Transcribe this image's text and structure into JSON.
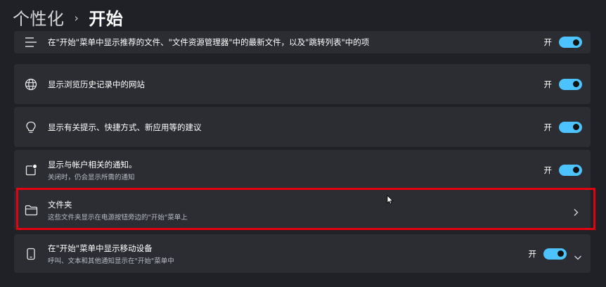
{
  "header": {
    "parent": "个性化",
    "separator": "›",
    "current": "开始"
  },
  "rows": [
    {
      "icon": "list-lines-icon",
      "title": "在\"开始\"菜单中显示推荐的文件、\"文件资源管理器\"中的最新文件，以及\"跳转列表\"中的项",
      "toggle_label": "开",
      "toggle_on": true
    },
    {
      "icon": "globe-icon",
      "title": "显示浏览历史记录中的网站",
      "toggle_label": "开",
      "toggle_on": true
    },
    {
      "icon": "lightbulb-icon",
      "title": "显示有关提示、快捷方式、新应用等的建议",
      "toggle_label": "开",
      "toggle_on": true
    },
    {
      "icon": "account-notification-icon",
      "title": "显示与帐户相关的通知。",
      "subtitle": "关闭时，仍会显示所需的通知",
      "toggle_label": "开",
      "toggle_on": true
    },
    {
      "icon": "folder-icon",
      "title": "文件夹",
      "subtitle": "这些文件夹显示在电源按钮旁边的\"开始\"菜单上"
    },
    {
      "icon": "phone-icon",
      "title": "在\"开始\"菜单中显示移动设备",
      "subtitle": "呼叫、文本和其他通知显示在\"开始\"菜单中",
      "toggle_label": "开",
      "toggle_on": true
    }
  ],
  "colors": {
    "background": "#1f2127",
    "card": "#2b2d33",
    "accent": "#4cc2ff",
    "highlight": "#e3000f"
  }
}
